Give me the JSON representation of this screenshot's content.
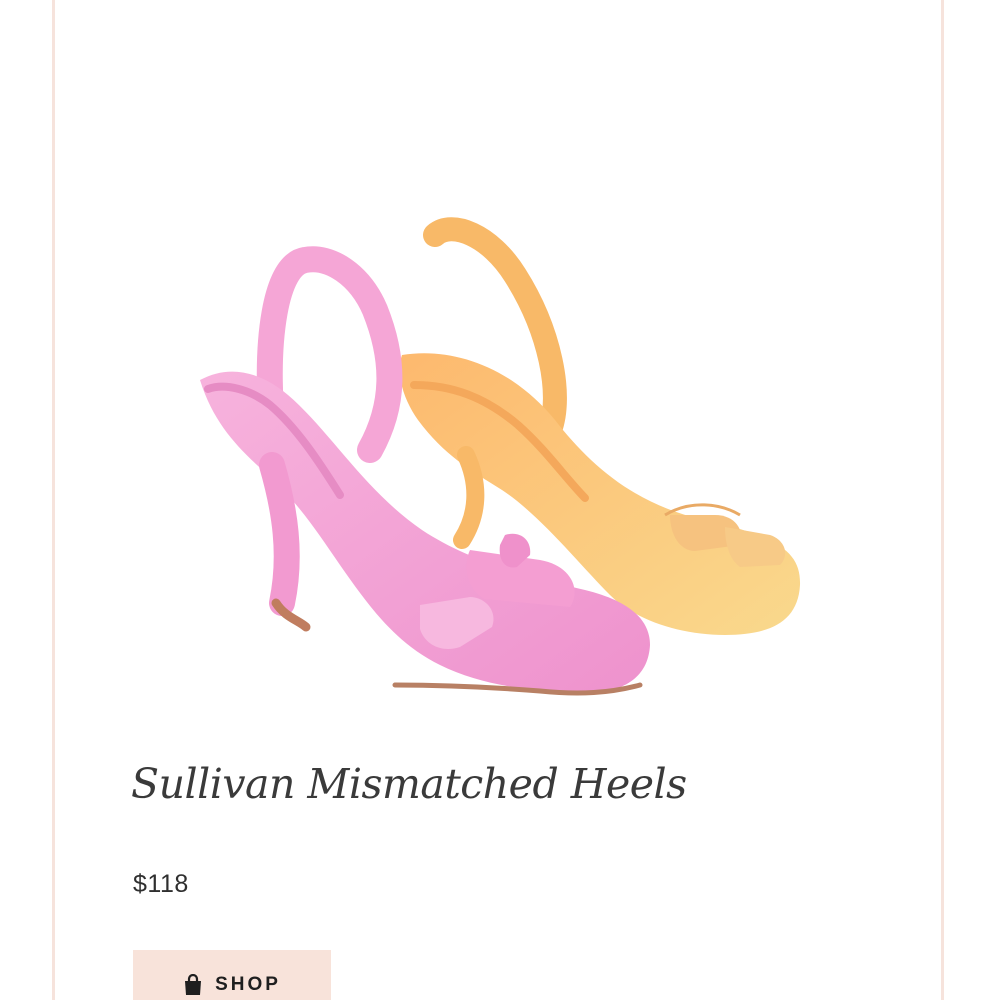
{
  "product": {
    "image_alt": "Pink and yellow slingback heels",
    "title": "Sullivan Mismatched Heels",
    "price": "$118"
  },
  "shop_button": {
    "label": "SHOP",
    "icon": "shopping-bag-icon"
  },
  "colors": {
    "card_border": "#f6e3dc",
    "button_background": "#f8e3da",
    "pink_shoe": "#f2a6d6",
    "yellow_shoe": "#f8c98a"
  }
}
